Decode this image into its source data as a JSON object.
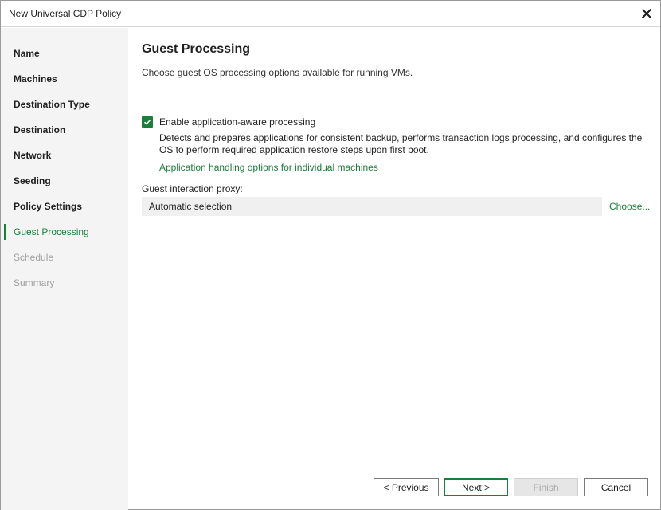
{
  "window": {
    "title": "New Universal CDP Policy"
  },
  "sidebar": {
    "items": [
      {
        "label": "Name",
        "state": "normal"
      },
      {
        "label": "Machines",
        "state": "normal"
      },
      {
        "label": "Destination Type",
        "state": "normal"
      },
      {
        "label": "Destination",
        "state": "normal"
      },
      {
        "label": "Network",
        "state": "normal"
      },
      {
        "label": "Seeding",
        "state": "normal"
      },
      {
        "label": "Policy Settings",
        "state": "normal"
      },
      {
        "label": "Guest Processing",
        "state": "active"
      },
      {
        "label": "Schedule",
        "state": "disabled"
      },
      {
        "label": "Summary",
        "state": "disabled"
      }
    ]
  },
  "main": {
    "title": "Guest Processing",
    "subtitle": "Choose guest OS processing options available for running VMs.",
    "app_aware": {
      "checked": true,
      "label": "Enable application-aware processing",
      "description": "Detects and prepares applications for consistent backup, performs transaction logs processing, and configures the OS to perform required application restore steps upon first boot.",
      "link": "Application handling options for individual machines"
    },
    "proxy": {
      "label": "Guest interaction proxy:",
      "value": "Automatic selection",
      "choose_link": "Choose..."
    }
  },
  "footer": {
    "previous": "< Previous",
    "next": "Next >",
    "finish": "Finish",
    "cancel": "Cancel"
  },
  "colors": {
    "accent": "#1a7f3a",
    "sidebar_bg": "#f4f4f4",
    "disabled_text": "#a0a0a0"
  },
  "icons": {
    "close": "close-icon",
    "checkbox": "checkmark-icon"
  }
}
